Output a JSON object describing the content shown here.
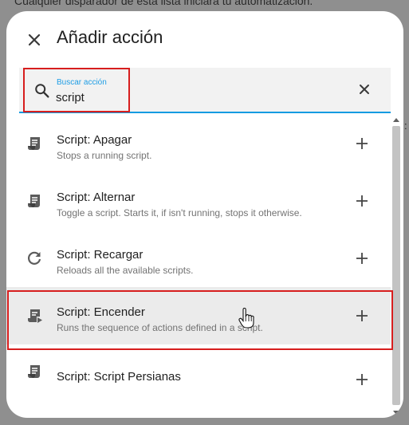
{
  "background": {
    "text": "Cualquier disparador de esta lista iniciará tu automatización."
  },
  "dialog": {
    "title": "Añadir acción",
    "close_icon": "close-icon"
  },
  "search": {
    "label": "Buscar acción",
    "value": "script",
    "search_icon": "search-icon",
    "clear_icon": "clear-icon"
  },
  "actions": [
    {
      "title": "Script: Apagar",
      "description": "Stops a running script.",
      "icon": "script-text-icon",
      "add_icon": "plus-icon"
    },
    {
      "title": "Script: Alternar",
      "description": "Toggle a script. Starts it, if isn't running, stops it otherwise.",
      "icon": "script-text-icon",
      "add_icon": "plus-icon"
    },
    {
      "title": "Script: Recargar",
      "description": "Reloads all the available scripts.",
      "icon": "reload-icon",
      "add_icon": "plus-icon"
    },
    {
      "title": "Script: Encender",
      "description": "Runs the sequence of actions defined in a script.",
      "icon": "script-play-icon",
      "add_icon": "plus-icon",
      "hovered": true
    },
    {
      "title": "Script: Script Persianas",
      "description": "",
      "icon": "script-text-icon",
      "add_icon": "plus-icon"
    }
  ],
  "colors": {
    "accent": "#0f9be1",
    "highlight": "#d71e1e",
    "hover_row": "#ebebeb"
  }
}
